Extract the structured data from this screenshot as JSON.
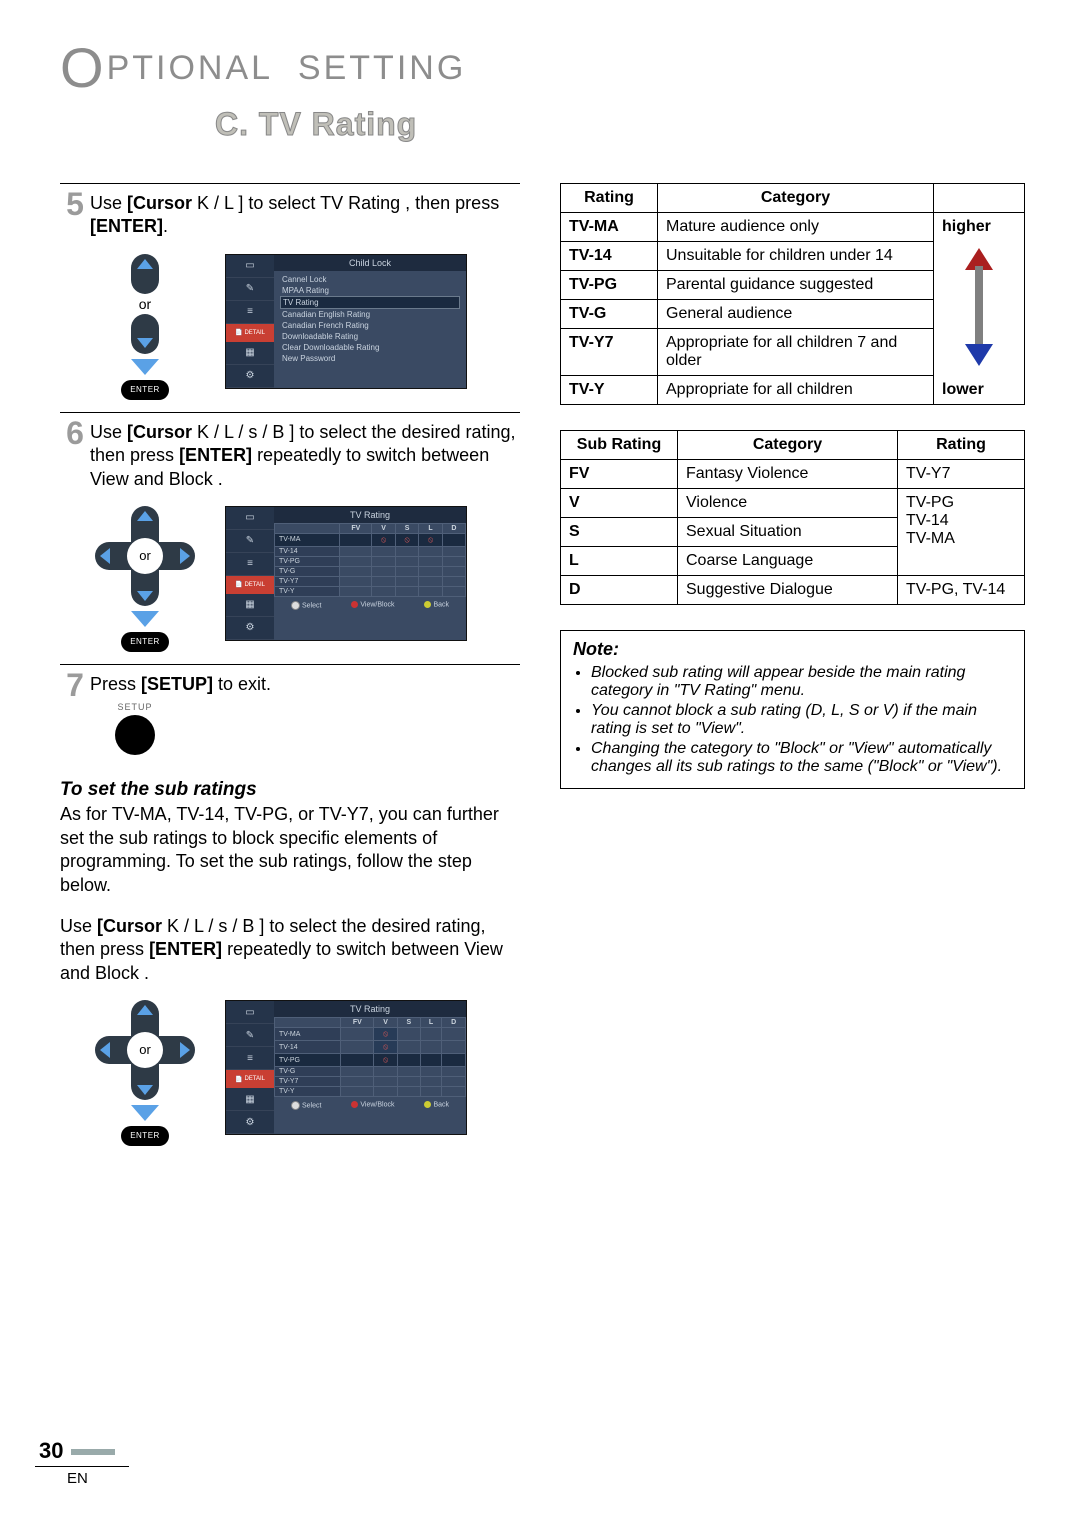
{
  "header": {
    "chapter_letter": "O",
    "chapter_rest": "PTIONAL  SETTING",
    "section": "C. TV Rating"
  },
  "steps": {
    "s5_num": "5",
    "s5_a": "Use ",
    "s5_b": "[Cursor ",
    "s5_c": "K / L ]",
    "s5_d": " to select  TV Rating , then press ",
    "s5_e": "[ENTER]",
    "s5_f": ".",
    "dpad_or": "or",
    "enter": "ENTER",
    "menu1_title": "Child Lock",
    "menu1_items": [
      "Cannel Lock",
      "MPAA Rating",
      "TV Rating",
      "Canadian English Rating",
      "Canadian French Rating",
      "Downloadable Rating",
      "Clear Downloadable Rating",
      "New Password"
    ],
    "detail": "DETAIL",
    "s6_num": "6",
    "s6_a": "Use ",
    "s6_b": "[Cursor ",
    "s6_c": "K / L / s / B ]",
    "s6_d": " to select the desired rating, then press ",
    "s6_e": "[ENTER]",
    "s6_f": " repeatedly to switch between  View  and  Block .",
    "menu2_title": "TV Rating",
    "menu2_rows": [
      "TV-MA",
      "TV-14",
      "TV-PG",
      "TV-G",
      "TV-Y7",
      "TV-Y"
    ],
    "menu2_cols": [
      "FV",
      "V",
      "S",
      "L",
      "D"
    ],
    "foot_select": "Select",
    "foot_view": "View/Block",
    "foot_back": "Back",
    "s7_num": "7",
    "s7_a": "Press ",
    "s7_b": "[SETUP]",
    "s7_c": " to exit.",
    "setup_label": "SETUP",
    "sub_head": "To set the sub ratings",
    "sub_p1": "As for TV-MA, TV-14, TV-PG, or TV-Y7, you can further set the sub ratings to block specific elements of programming. To set the sub ratings, follow the step below.",
    "sub_p2a": "Use ",
    "sub_p2b": "[Cursor ",
    "sub_p2c": "K / L / s / B ]",
    "sub_p2d": " to select the desired rating, then press ",
    "sub_p2e": "[ENTER]",
    "sub_p2f": " repeatedly to switch between  View  and  Block ."
  },
  "rating_table": {
    "head_rating": "Rating",
    "head_category": "Category",
    "scale_hi": "higher",
    "scale_lo": "lower",
    "rows": [
      {
        "r": "TV-MA",
        "c": "Mature audience only"
      },
      {
        "r": "TV-14",
        "c": "Unsuitable for children under 14"
      },
      {
        "r": "TV-PG",
        "c": "Parental guidance suggested"
      },
      {
        "r": "TV-G",
        "c": "General audience"
      },
      {
        "r": "TV-Y7",
        "c": "Appropriate for all children 7 and older"
      },
      {
        "r": "TV-Y",
        "c": "Appropriate for all children"
      }
    ]
  },
  "sub_table": {
    "head_sub": "Sub Rating",
    "head_category": "Category",
    "head_rating": "Rating",
    "rows": [
      {
        "s": "FV",
        "c": "Fantasy Violence",
        "r": "TV-Y7"
      },
      {
        "s": "V",
        "c": "Violence",
        "r": ""
      },
      {
        "s": "S",
        "c": "Sexual Situation",
        "r": ""
      },
      {
        "s": "L",
        "c": "Coarse Language",
        "r": ""
      },
      {
        "s": "D",
        "c": "Suggestive Dialogue",
        "r": "TV-PG, TV-14"
      }
    ],
    "span_rating": "TV-PG\nTV-14\nTV-MA"
  },
  "note": {
    "head": "Note:",
    "items": [
      "Blocked sub rating will appear beside the main rating category in \"TV Rating\" menu.",
      "You cannot block a sub rating (D, L, S or V) if the main rating is set to \"View\".",
      "Changing the category to \"Block\" or \"View\" automatically changes all its sub ratings to the same (\"Block\" or \"View\")."
    ]
  },
  "footer": {
    "page": "30",
    "lang": "EN"
  }
}
